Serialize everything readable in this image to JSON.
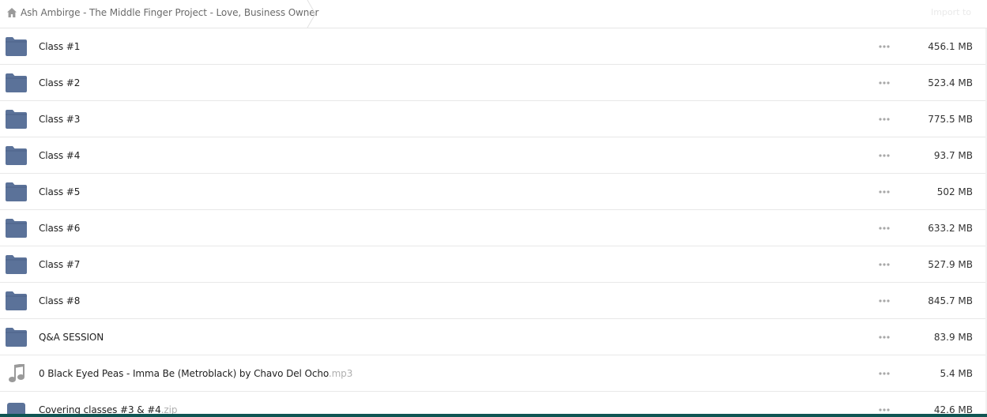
{
  "breadcrumb": {
    "home_icon": "home-icon",
    "label": "Ash Ambirge - The Middle Finger Project - Love, Business Owner"
  },
  "header": {
    "action_label": "Import to"
  },
  "colors": {
    "folder": "#5b7299",
    "file_icon": "#9a9a9a",
    "border": "#e8e8e8",
    "bottom_bar": "#0f5553"
  },
  "files": [
    {
      "name": "Class #1",
      "ext": "",
      "size": "456.1 MB",
      "icon": "folder-icon"
    },
    {
      "name": "Class #2",
      "ext": "",
      "size": "523.4 MB",
      "icon": "folder-icon"
    },
    {
      "name": "Class #3",
      "ext": "",
      "size": "775.5 MB",
      "icon": "folder-icon"
    },
    {
      "name": "Class #4",
      "ext": "",
      "size": "93.7 MB",
      "icon": "folder-icon"
    },
    {
      "name": "Class #5",
      "ext": "",
      "size": "502 MB",
      "icon": "folder-icon"
    },
    {
      "name": "Class #6",
      "ext": "",
      "size": "633.2 MB",
      "icon": "folder-icon"
    },
    {
      "name": "Class #7",
      "ext": "",
      "size": "527.9 MB",
      "icon": "folder-icon"
    },
    {
      "name": "Class #8",
      "ext": "",
      "size": "845.7 MB",
      "icon": "folder-icon"
    },
    {
      "name": "Q&A SESSION",
      "ext": "",
      "size": "83.9 MB",
      "icon": "folder-icon"
    },
    {
      "name": "0 Black Eyed Peas - Imma Be (Metroblack) by Chavo Del Ocho",
      "ext": ".mp3",
      "size": "5.4 MB",
      "icon": "music-note-icon"
    },
    {
      "name": "Covering classes #3 & #4",
      "ext": ".zip",
      "size": "42.6 MB",
      "icon": "archive-icon"
    }
  ]
}
